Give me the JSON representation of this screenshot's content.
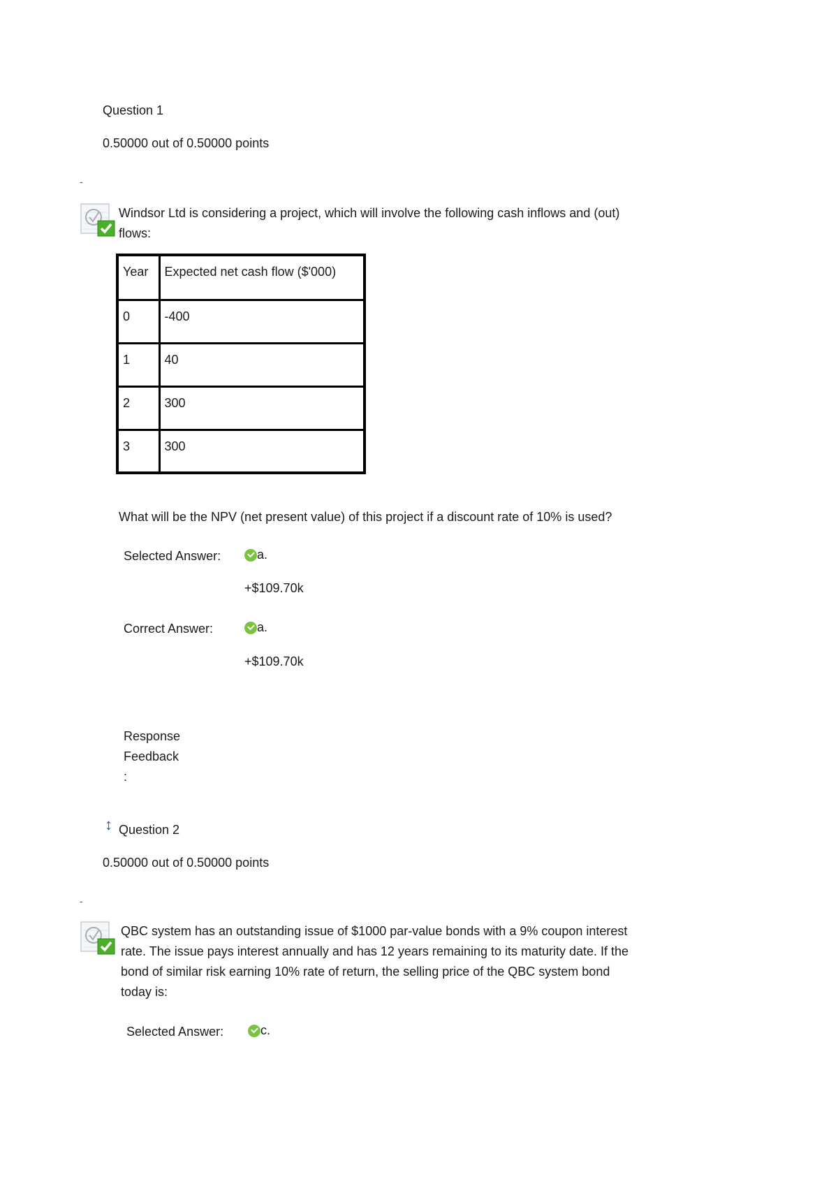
{
  "questions": [
    {
      "title": "Question 1",
      "points": "0.50000 out of 0.50000 points",
      "marker": "-",
      "text_line1": "Windsor Ltd is considering a project, which will involve the following cash inflows and (out)",
      "text_line2": "flows:",
      "table": {
        "headers": [
          "Year",
          "Expected net cash flow ($'000)"
        ],
        "rows": [
          [
            "0",
            "-400"
          ],
          [
            "1",
            "40"
          ],
          [
            "2",
            "300"
          ],
          [
            "3",
            "300"
          ]
        ]
      },
      "prompt": "What will be the NPV (net present value) of this project if a discount rate of 10% is used?",
      "selected_answer": {
        "label": "Selected Answer:",
        "letter": "a.",
        "value": "+$109.70k"
      },
      "correct_answer": {
        "label": "Correct Answer:",
        "letter": "a.",
        "value": "+$109.70k"
      },
      "feedback_label": [
        "Response",
        "Feedback",
        ":"
      ]
    },
    {
      "title": "Question 2",
      "points": "0.50000 out of 0.50000 points",
      "marker": "-",
      "text_lines": [
        "QBC system has an outstanding issue of $1000 par-value bonds with a 9% coupon interest",
        "rate. The issue pays interest annually and has 12 years remaining to its maturity date. If the",
        "bond of similar risk earning 10% rate of return, the selling price of the QBC system bond",
        "today is:"
      ],
      "selected_answer": {
        "label": "Selected Answer:",
        "letter": "c."
      }
    }
  ],
  "colors": {
    "correct_check": "#7cc242",
    "link_blue": "#2244cc"
  }
}
